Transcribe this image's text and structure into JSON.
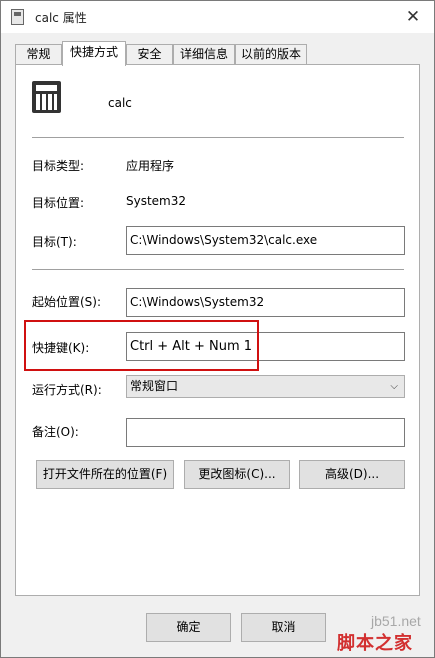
{
  "window": {
    "title": "calc 属性",
    "close_glyph": "✕"
  },
  "tabs": [
    {
      "label": "常规"
    },
    {
      "label": "快捷方式"
    },
    {
      "label": "安全"
    },
    {
      "label": "详细信息"
    },
    {
      "label": "以前的版本"
    }
  ],
  "active_tab": "快捷方式",
  "app": {
    "name": "calc",
    "icon": "calculator-icon"
  },
  "target_type": {
    "label": "目标类型:",
    "value": "应用程序"
  },
  "target_location": {
    "label": "目标位置:",
    "value": "System32"
  },
  "target": {
    "label": "目标(T):",
    "value": "C:\\Windows\\System32\\calc.exe"
  },
  "start_in": {
    "label": "起始位置(S):",
    "value": "C:\\Windows\\System32"
  },
  "shortcut_key": {
    "label": "快捷键(K):",
    "value": "Ctrl + Alt + Num 1"
  },
  "run": {
    "label": "运行方式(R):",
    "value": "常规窗口"
  },
  "comment": {
    "label": "备注(O):",
    "value": ""
  },
  "buttons": {
    "open_location": "打开文件所在的位置(F)",
    "change_icon": "更改图标(C)...",
    "advanced": "高级(D)..."
  },
  "footer": {
    "ok": "确定",
    "cancel": "取消"
  },
  "watermark": {
    "url": "jb51.net",
    "site": "脚本之家"
  },
  "colors": {
    "highlight": "#d01010",
    "watermark": "#d23030"
  }
}
